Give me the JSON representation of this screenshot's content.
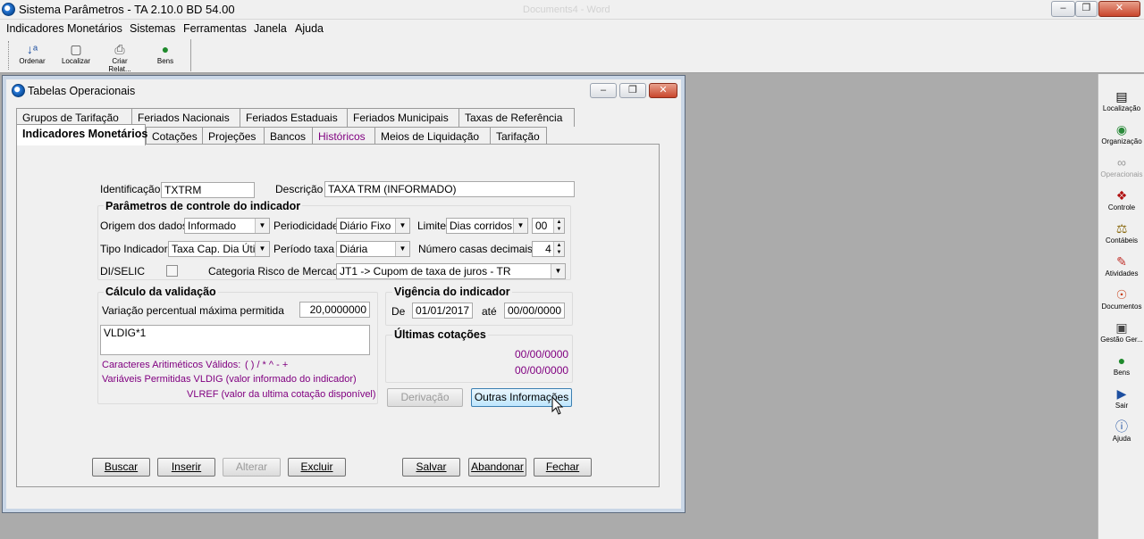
{
  "app": {
    "title": "Sistema Parâmetros -  TA 2.10.0 BD 54.00",
    "ghost_title": "Documents4 - Word"
  },
  "menu": [
    "Indicadores Monetários",
    "Sistemas",
    "Ferramentas",
    "Janela",
    "Ajuda"
  ],
  "toolbar": {
    "items": [
      {
        "label": "Ordenar",
        "icon": "sort-az-icon"
      },
      {
        "label": "Localizar",
        "icon": "find-icon"
      },
      {
        "label": "Criar Relat...",
        "icon": "printer-icon"
      },
      {
        "label": "Bens",
        "icon": "money-bag-icon"
      }
    ]
  },
  "right_panel": [
    {
      "label": "Localização",
      "icon": "location-icon",
      "enabled": true
    },
    {
      "label": "Organização",
      "icon": "organization-icon",
      "enabled": true
    },
    {
      "label": "Operacionais",
      "icon": "operational-icon",
      "enabled": false
    },
    {
      "label": "Controle",
      "icon": "control-icon",
      "enabled": true
    },
    {
      "label": "Contábeis",
      "icon": "scales-icon",
      "enabled": true
    },
    {
      "label": "Atividades",
      "icon": "pencil-icon",
      "enabled": true
    },
    {
      "label": "Documentos",
      "icon": "documents-icon",
      "enabled": true
    },
    {
      "label": "Gestão Ger...",
      "icon": "management-icon",
      "enabled": true
    },
    {
      "label": "Bens",
      "icon": "money-bag-icon",
      "enabled": true
    },
    {
      "label": "Sair",
      "icon": "exit-icon",
      "enabled": true
    },
    {
      "label": "Ajuda",
      "icon": "help-icon",
      "enabled": true
    }
  ],
  "window": {
    "title": "Tabelas Operacionais",
    "tabs_row1": [
      "Grupos de Tarifação",
      "Feriados Nacionais",
      "Feriados Estaduais",
      "Feriados Municipais",
      "Taxas de Referência"
    ],
    "tabs_row2": [
      "Indicadores Monetários",
      "Cotações",
      "Projeções",
      "Bancos",
      "Históricos",
      "Meios de Liquidação",
      "Tarifação"
    ],
    "active_tab": "Indicadores Monetários"
  },
  "form": {
    "identificacao_label": "Identificação",
    "identificacao_value": "TXTRM",
    "descricao_label": "Descrição",
    "descricao_value": "TAXA TRM (INFORMADO)",
    "params_title": "Parâmetros de controle do indicador",
    "origem_label": "Origem dos dados",
    "origem_value": "Informado",
    "periodicidade_label": "Periodicidade",
    "periodicidade_value": "Diário Fixo",
    "limite_label": "Limite",
    "limite_value": "Dias corridos",
    "limite_num": "00",
    "tipo_label": "Tipo Indicador",
    "tipo_value": "Taxa Cap. Dia Útil",
    "periodo_label": "Período taxa",
    "periodo_value": "Diária",
    "casas_label": "Número casas decimais",
    "casas_value": "4",
    "diselic_label": "DI/SELIC",
    "categoria_label": "Categoria Risco de Mercado",
    "categoria_value": "JT1 -> Cupom de taxa de juros - TR",
    "calc_title": "Cálculo da validação",
    "variacao_label": "Variação percentual máxima permitida",
    "variacao_value": "20,0000000",
    "formula_value": "VLDIG*1",
    "caracteres_label": "Caracteres Aritiméticos Válidos:",
    "caracteres_value": "( ) / * ^ - +",
    "variaveis_line1": "Variáveis Permitidas VLDIG  (valor informado do indicador)",
    "variaveis_line2": "VLREF (valor da ultima cotação disponível)",
    "vigencia_title": "Vigência do indicador",
    "de_label": "De",
    "de_value": "01/01/2017",
    "ate_label": "até",
    "ate_value": "00/00/0000",
    "ultimas_title": "Últimas cotações",
    "cotacao1": "00/00/0000",
    "cotacao2": "00/00/0000"
  },
  "buttons": {
    "derivacao": "Derivação",
    "outras": "Outras Informações",
    "buscar": "Buscar",
    "inserir": "Inserir",
    "alterar": "Alterar",
    "excluir": "Excluir",
    "salvar": "Salvar",
    "abandonar": "Abandonar",
    "fechar": "Fechar"
  }
}
